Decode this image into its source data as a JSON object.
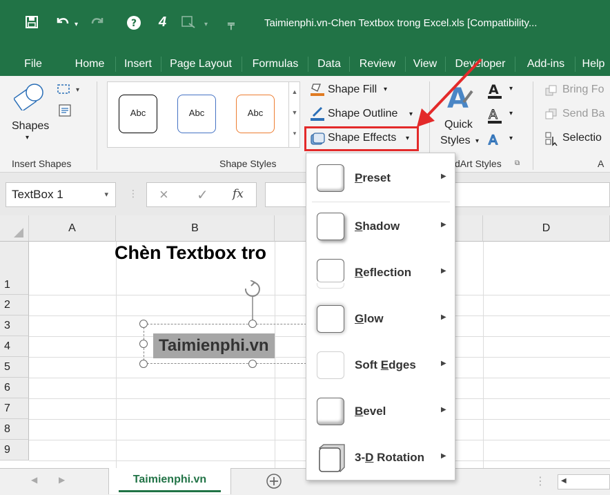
{
  "title": "Taimienphi.vn-Chen Textbox trong Excel.xls  [Compatibility...",
  "tabs": [
    "File",
    "Home",
    "Insert",
    "Page Layout",
    "Formulas",
    "Data",
    "Review",
    "View",
    "Developer",
    "Add-ins",
    "Help"
  ],
  "ribbon": {
    "insert_shapes": {
      "label": "Shapes",
      "group": "Insert Shapes"
    },
    "shape_styles": {
      "sample": "Abc",
      "group": "Shape Styles"
    },
    "shape_fill": "Shape Fill",
    "shape_outline": "Shape Outline",
    "shape_effects": "Shape Effects",
    "quick_styles_1": "Quick",
    "quick_styles_2": "Styles",
    "wordart_group": "dArt Styles",
    "bring_forward": "Bring Fo",
    "send_backward": "Send Ba",
    "selection": "Selectio",
    "arrange_group": "A"
  },
  "formula_bar": {
    "name_box": "TextBox 1",
    "fx": "fx",
    "cancel": "×",
    "enter": "✓"
  },
  "columns": [
    "A",
    "B",
    "D"
  ],
  "rows": [
    "1",
    "2",
    "3",
    "4",
    "5",
    "6",
    "7",
    "8",
    "9"
  ],
  "cells": {
    "b1": "Chèn Textbox tro"
  },
  "textbox": {
    "text": "Taimienphi.vn"
  },
  "sheet_tab": "Taimienphi.vn",
  "menu": {
    "items": [
      {
        "pre": "",
        "ul": "P",
        "post": "reset"
      },
      {
        "pre": "",
        "ul": "S",
        "post": "hadow"
      },
      {
        "pre": "",
        "ul": "R",
        "post": "eflection"
      },
      {
        "pre": "",
        "ul": "G",
        "post": "low"
      },
      {
        "pre": "Soft ",
        "ul": "E",
        "post": "dges"
      },
      {
        "pre": "",
        "ul": "B",
        "post": "evel"
      },
      {
        "pre": "3-",
        "ul": "D",
        "post": " Rotation"
      }
    ]
  },
  "colors": {
    "accent": "#217346",
    "highlight": "#e32a2a"
  }
}
